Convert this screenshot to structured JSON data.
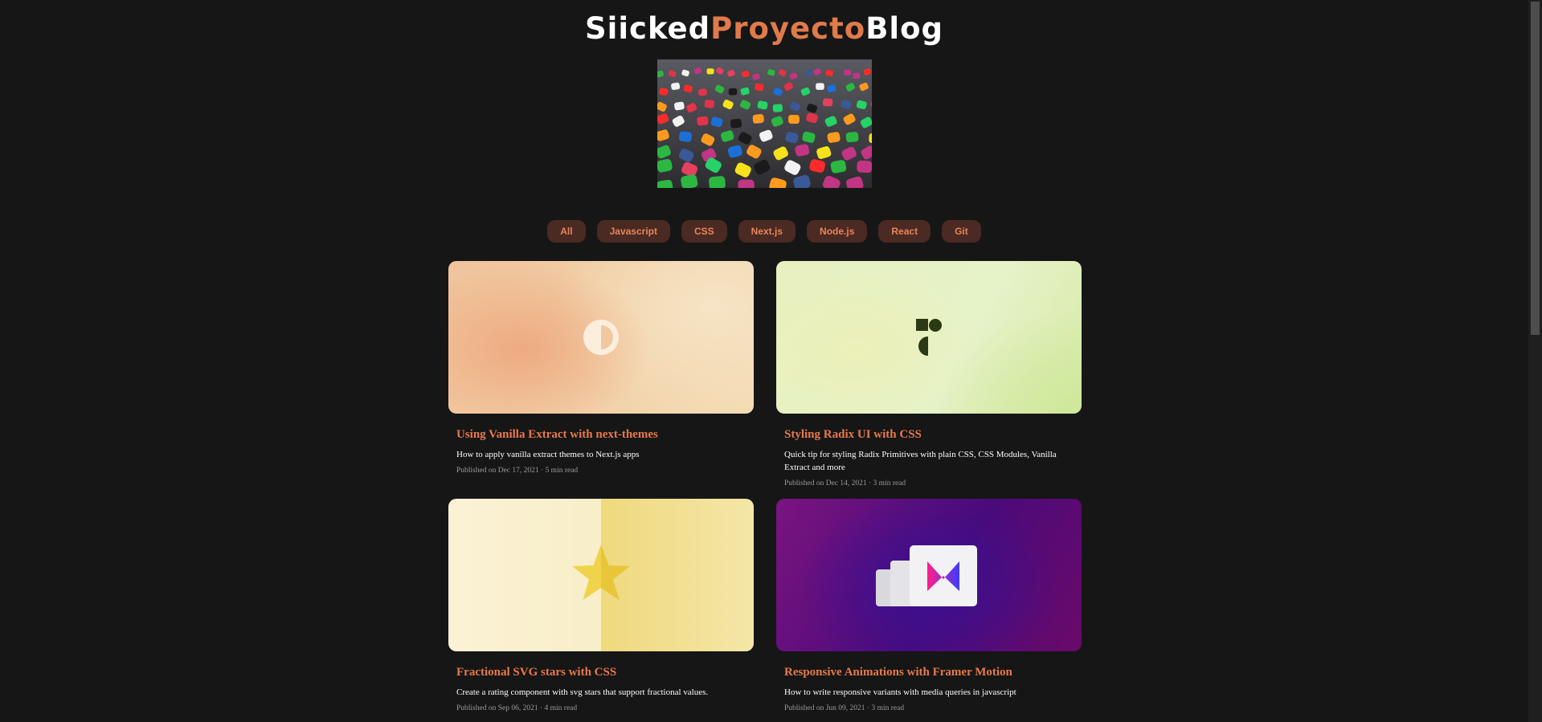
{
  "header": {
    "title_part1": "Siicked",
    "title_part2": "Proyecto",
    "title_part3": "Blog"
  },
  "hero_image": {
    "alt": "social media icons",
    "accent": "#e07a4a"
  },
  "tags": [
    "All",
    "Javascript",
    "CSS",
    "Next.js",
    "Node.js",
    "React",
    "Git"
  ],
  "posts": [
    {
      "title": "Using Vanilla Extract with next-themes",
      "description": "How to apply vanilla extract themes to Next.js apps",
      "meta": "Published on Dec 17, 2021 · 5 min read",
      "icon": "contrast-icon"
    },
    {
      "title": "Styling Radix UI with CSS",
      "description": "Quick tip for styling Radix Primitives with plain CSS, CSS Modules, Vanilla Extract and more",
      "meta": "Published on Dec 14, 2021 · 3 min read",
      "icon": "radix-logo-icon"
    },
    {
      "title": "Fractional SVG stars with CSS",
      "description": "Create a rating component with svg stars that support fractional values.",
      "meta": "Published on Sep 06, 2021 · 4 min read",
      "icon": "star-icon"
    },
    {
      "title": "Responsive Animations with Framer Motion",
      "description": "How to write responsive variants with media queries in javascript",
      "meta": "Published on Jun 09, 2021 · 3 min read",
      "icon": "framer-motion-icon"
    }
  ]
}
